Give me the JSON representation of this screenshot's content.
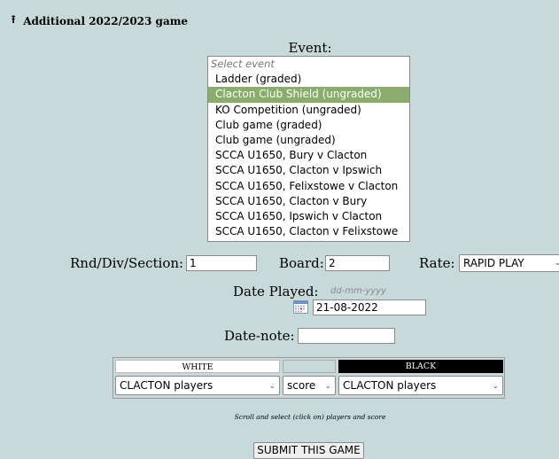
{
  "header": {
    "icon": "up-arrow-icon",
    "title": "Additional 2022/2023 game"
  },
  "event": {
    "label": "Event:",
    "options": [
      "Select event",
      "Ladder (graded)",
      "Clacton Club Shield (ungraded)",
      "KO Competition (ungraded)",
      "Club game (graded)",
      "Club game (ungraded)",
      "SCCA U1650, Bury v Clacton",
      "SCCA U1650, Clacton v Ipswich",
      "SCCA U1650, Felixstowe v Clacton",
      "SCCA U1650, Clacton v Bury",
      "SCCA U1650, Ipswich v Clacton",
      "SCCA U1650, Clacton v Felixstowe"
    ],
    "selected": "Clacton Club Shield (ungraded)"
  },
  "round": {
    "label": "Rnd/Div/Section:",
    "value": "1"
  },
  "board": {
    "label": "Board:",
    "value": "2"
  },
  "rate": {
    "label": "Rate:",
    "value": "RAPID PLAY"
  },
  "date": {
    "label": "Date Played:",
    "hint": "dd-mm-yyyy",
    "value": "21-08-2022",
    "icon": "calendar-icon"
  },
  "datenote": {
    "label": "Date-note:",
    "value": ""
  },
  "players": {
    "white_header": "WHITE",
    "black_header": "BLACK",
    "white_value": "CLACTON players",
    "score_value": "score",
    "black_value": "CLACTON players"
  },
  "note": "Scroll and select (click on) players and score",
  "submit": "SUBMIT THIS GAME",
  "colors": {
    "background": "#c7d9d9",
    "selected": "#8aad6c",
    "black_header": "#000000"
  }
}
